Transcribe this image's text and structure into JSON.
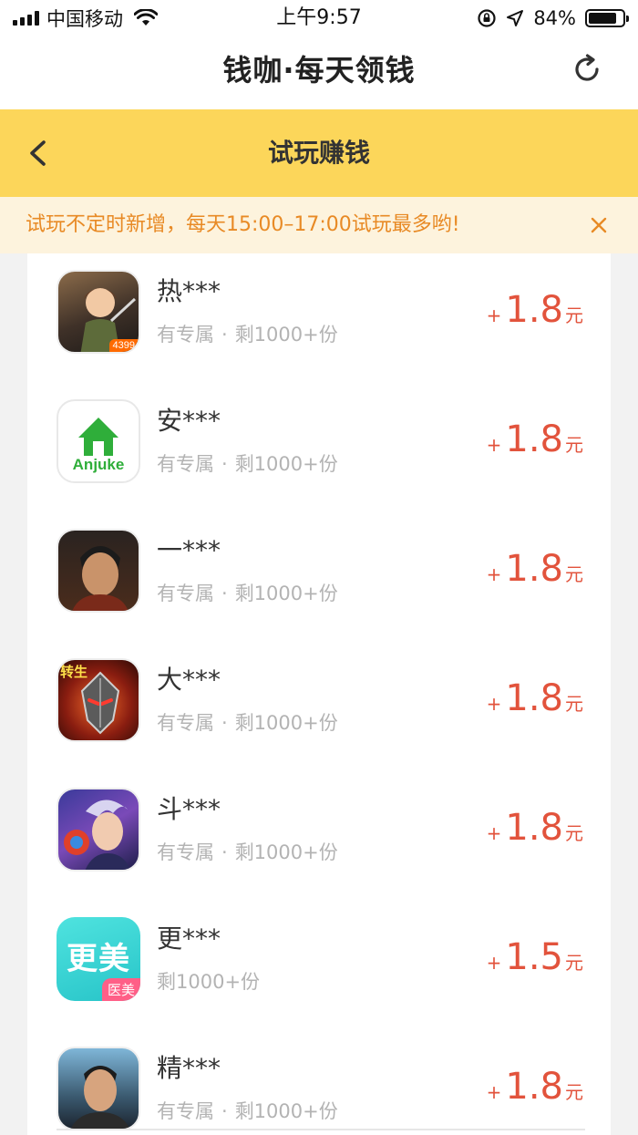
{
  "status_bar": {
    "carrier": "中国移动",
    "time": "上午9:57",
    "battery": "84%",
    "battery_level": 0.84
  },
  "header": {
    "title": "钱咖·每天领钱",
    "refresh_icon": "refresh-icon"
  },
  "nav": {
    "title": "试玩赚钱",
    "back_icon": "chevron-left-icon"
  },
  "notice": {
    "text": "试玩不定时新增，每天15:00–17:00试玩最多哟!",
    "close_icon": "close-icon"
  },
  "colors": {
    "nav_yellow": "#fcd65a",
    "notice_bg": "#fdf3dd",
    "notice_text": "#e88a25",
    "reward_red": "#e2533c"
  },
  "apps": [
    {
      "name": "热***",
      "tag": "有专属",
      "dot": "·",
      "stock": "剩1000+份",
      "plus": "+",
      "amount": "1.8",
      "unit": "元",
      "badge": "4399",
      "icon": "game-warrior-icon"
    },
    {
      "name": "安***",
      "tag": "有专属",
      "dot": "·",
      "stock": "剩1000+份",
      "plus": "+",
      "amount": "1.8",
      "unit": "元",
      "badge": "Anjuke",
      "icon": "anjuke-house-icon"
    },
    {
      "name": "一***",
      "tag": "有专属",
      "dot": "·",
      "stock": "剩1000+份",
      "plus": "+",
      "amount": "1.8",
      "unit": "元",
      "badge": "",
      "icon": "actor-portrait-icon"
    },
    {
      "name": "大***",
      "tag": "有专属",
      "dot": "·",
      "stock": "剩1000+份",
      "plus": "+",
      "amount": "1.8",
      "unit": "元",
      "badge": "转生",
      "icon": "armor-mask-icon"
    },
    {
      "name": "斗***",
      "tag": "有专属",
      "dot": "·",
      "stock": "剩1000+份",
      "plus": "+",
      "amount": "1.8",
      "unit": "元",
      "badge": "",
      "icon": "anime-hero-icon"
    },
    {
      "name": "更***",
      "tag": "",
      "dot": "",
      "stock": "剩1000+份",
      "plus": "+",
      "amount": "1.5",
      "unit": "元",
      "badge": "更美",
      "badge2": "医美",
      "icon": "gengmei-icon"
    },
    {
      "name": "精***",
      "tag": "有专属",
      "dot": "·",
      "stock": "剩1000+份",
      "plus": "+",
      "amount": "1.8",
      "unit": "元",
      "badge": "",
      "icon": "actor-portrait-icon"
    }
  ]
}
